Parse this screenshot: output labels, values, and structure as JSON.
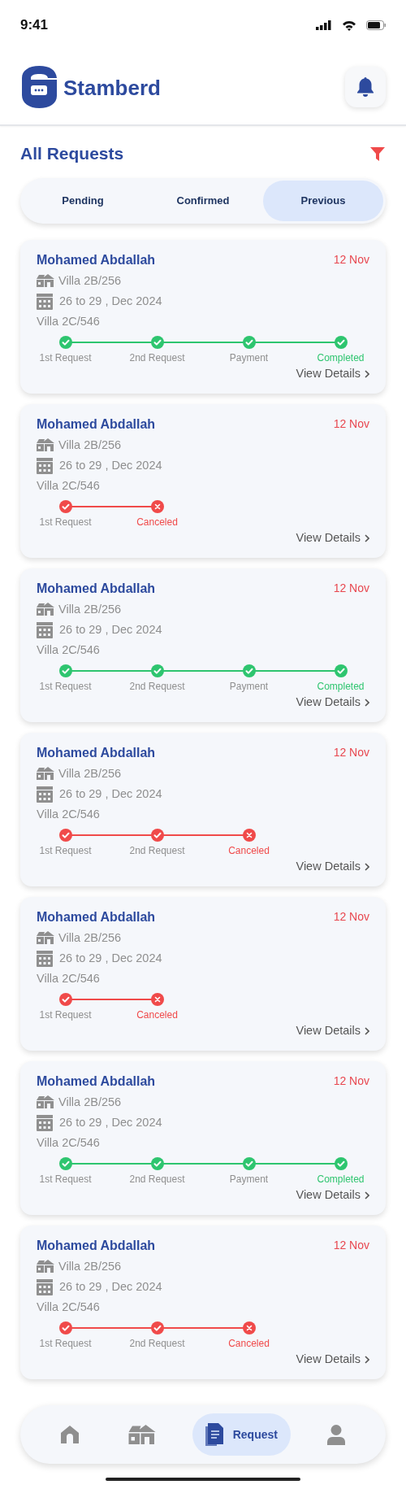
{
  "status_bar": {
    "time": "9:41"
  },
  "header": {
    "app_name": "Stamberd"
  },
  "page_title": "All Requests",
  "tabs": [
    {
      "label": "Pending",
      "selected": false
    },
    {
      "label": "Confirmed",
      "selected": false
    },
    {
      "label": "Previous",
      "selected": true
    }
  ],
  "requests": [
    {
      "name": "Mohamed Abdallah",
      "date": "12 Nov",
      "property": "Villa 2B/256",
      "dates": "26 to 29 , Dec 2024",
      "unit": "Villa 2C/546",
      "canceled": false,
      "steps": [
        {
          "label": "1st Request",
          "kind": "step"
        },
        {
          "label": "2nd Request",
          "kind": "step"
        },
        {
          "label": "Payment",
          "kind": "step"
        },
        {
          "label": "Completed",
          "kind": "completed"
        }
      ],
      "link": "View Details"
    },
    {
      "name": "Mohamed Abdallah",
      "date": "12 Nov",
      "property": "Villa 2B/256",
      "dates": "26 to 29 , Dec 2024",
      "unit": "Villa 2C/546",
      "canceled": true,
      "steps": [
        {
          "label": "1st Request",
          "kind": "step"
        },
        {
          "label": "Canceled",
          "kind": "canceled"
        }
      ],
      "link": "View Details"
    },
    {
      "name": "Mohamed Abdallah",
      "date": "12 Nov",
      "property": "Villa 2B/256",
      "dates": "26 to 29 , Dec 2024",
      "unit": "Villa 2C/546",
      "canceled": false,
      "steps": [
        {
          "label": "1st Request",
          "kind": "step"
        },
        {
          "label": "2nd Request",
          "kind": "step"
        },
        {
          "label": "Payment",
          "kind": "step"
        },
        {
          "label": "Completed",
          "kind": "completed"
        }
      ],
      "link": "View Details"
    },
    {
      "name": "Mohamed Abdallah",
      "date": "12 Nov",
      "property": "Villa 2B/256",
      "dates": "26 to 29 , Dec 2024",
      "unit": "Villa 2C/546",
      "canceled": true,
      "steps": [
        {
          "label": "1st Request",
          "kind": "step"
        },
        {
          "label": "2nd Request",
          "kind": "step"
        },
        {
          "label": "Canceled",
          "kind": "canceled"
        }
      ],
      "link": "View Details"
    },
    {
      "name": "Mohamed Abdallah",
      "date": "12 Nov",
      "property": "Villa 2B/256",
      "dates": "26 to 29 , Dec 2024",
      "unit": "Villa 2C/546",
      "canceled": true,
      "steps": [
        {
          "label": "1st Request",
          "kind": "step"
        },
        {
          "label": "Canceled",
          "kind": "canceled"
        }
      ],
      "link": "View Details"
    },
    {
      "name": "Mohamed Abdallah",
      "date": "12 Nov",
      "property": "Villa 2B/256",
      "dates": "26 to 29 , Dec 2024",
      "unit": "Villa 2C/546",
      "canceled": false,
      "steps": [
        {
          "label": "1st Request",
          "kind": "step"
        },
        {
          "label": "2nd Request",
          "kind": "step"
        },
        {
          "label": "Payment",
          "kind": "step"
        },
        {
          "label": "Completed",
          "kind": "completed"
        }
      ],
      "link": "View Details"
    },
    {
      "name": "Mohamed Abdallah",
      "date": "12 Nov",
      "property": "Villa 2B/256",
      "dates": "26 to 29 , Dec 2024",
      "unit": "Villa 2C/546",
      "canceled": true,
      "steps": [
        {
          "label": "1st Request",
          "kind": "step"
        },
        {
          "label": "2nd Request",
          "kind": "step"
        },
        {
          "label": "Canceled",
          "kind": "canceled"
        }
      ],
      "link": "View Details"
    }
  ],
  "bottom_nav": [
    {
      "kind": "home",
      "selected": false
    },
    {
      "kind": "villas",
      "selected": false
    },
    {
      "kind": "request",
      "label": "Request",
      "selected": true
    },
    {
      "kind": "profile",
      "selected": false
    }
  ]
}
